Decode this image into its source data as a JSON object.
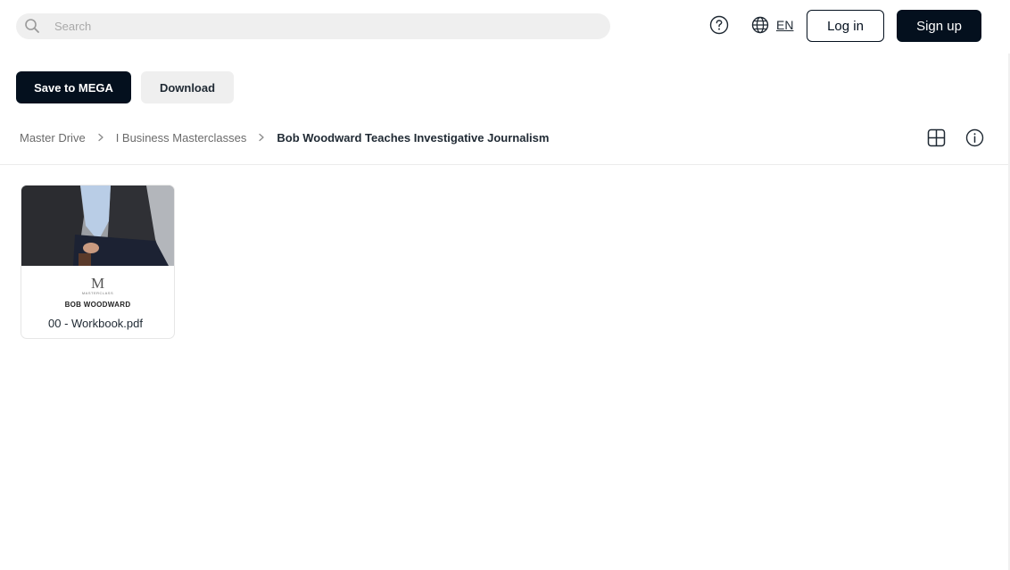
{
  "search": {
    "placeholder": "Search"
  },
  "header": {
    "language": "EN",
    "login_label": "Log in",
    "signup_label": "Sign up"
  },
  "actions": {
    "save_label": "Save to MEGA",
    "download_label": "Download"
  },
  "breadcrumb": [
    {
      "label": "Master Drive"
    },
    {
      "label": "I Business Masterclasses"
    },
    {
      "label": "Bob Woodward Teaches Investigative Journalism"
    }
  ],
  "files": [
    {
      "name": "00 - Workbook.pdf",
      "thumbnail": {
        "logo_letter": "M",
        "brand": "MASTERCLASS",
        "title": "BOB WOODWARD"
      }
    }
  ],
  "icons": {
    "search": "search-icon",
    "help": "help-icon",
    "language": "globe-icon",
    "view_toggle": "grid-view-icon",
    "info": "info-icon",
    "separator": "chevron-right-icon"
  },
  "colors": {
    "primary_dark": "#04101e",
    "secondary_button": "#efefef",
    "search_background": "#efefef",
    "breadcrumb_muted": "#6b6b6b"
  }
}
